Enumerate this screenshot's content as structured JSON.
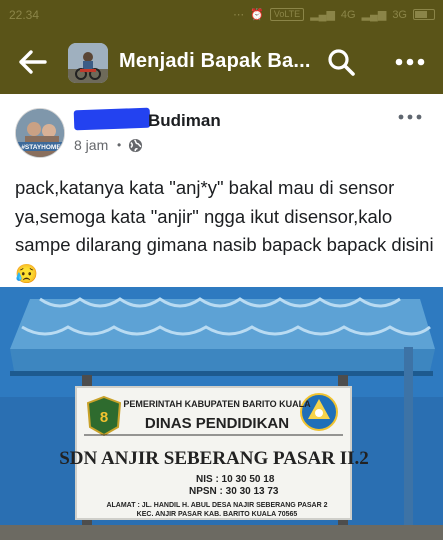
{
  "status_bar": {
    "time": "22.34",
    "network_badge": "VoLTE",
    "net1": "4G",
    "net2": "3G"
  },
  "app_bar": {
    "group_name": "Menjadi Bapak Ba..."
  },
  "post": {
    "author_visible": "Budiman",
    "avatar_badge": "#STAYHOME",
    "time": "8 jam",
    "separator": "•",
    "text": "pack,katanya kata \"anj*y\" bakal mau di sensor ya,semoga kata \"anjir\" ngga ikut disensor,kalo sampe dilarang gimana nasib bapack bapack disini 😥",
    "image": {
      "sign_line1": "PEMERINTAH KABUPATEN BARITO KUALA",
      "sign_line2": "DINAS PENDIDIKAN",
      "sign_line3": "SDN ANJIR SEBERANG PASAR II.2",
      "sign_nis": "NIS    : 10 30 50 18",
      "sign_npsn": "NPSN : 30 30 13 73",
      "sign_address1": "ALAMAT : JL. HANDIL H. ABUL DESA NAJIR SEBERANG PASAR 2",
      "sign_address2": "KEC. ANJIR PASAR KAB. BARITO KUALA 70565"
    }
  },
  "colors": {
    "app_bar": "#5a5418",
    "redaction": "#2342f0",
    "roof": "#4a93c9",
    "wall": "#1f63a8"
  }
}
